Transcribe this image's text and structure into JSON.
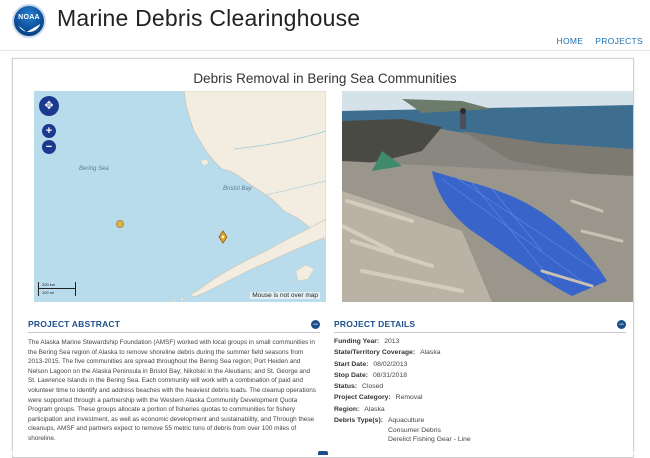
{
  "header": {
    "logo_text": "NOAA",
    "title": "Marine Debris Clearinghouse",
    "nav": [
      "HOME",
      "PROJECTS"
    ]
  },
  "page": {
    "title": "Debris Removal in Bering Sea Communities"
  },
  "map": {
    "sea_label": "Bering Sea",
    "bay_label": "Bristol Bay",
    "status": "Mouse is not over map",
    "scale_labels": [
      "200 km",
      "100 mi"
    ]
  },
  "abstract": {
    "heading": "PROJECT ABSTRACT",
    "text": "The Alaska Marine Stewardship Foundation (AMSF) worked with local groups in small communities in the Bering Sea region of Alaska to remove shoreline debris during the summer field seasons from 2013-2015. The five communities are spread throughout the Bering Sea region; Port Heiden and Nelson Lagoon on the Alaska Peninsula in Bristol Bay; Nikolski in the Aleutians; and St. George and St. Lawrence Islands in the Bering Sea. Each community will work with a combination of paid and volunteer time to identify and address beaches with the heaviest debris loads. The cleanup operations were supported through a partnership with the Western Alaska Community Development Quota Program groups. These groups allocate a portion of fisheries quotas to communities for fishery participation and investment, as well as economic development and sustainability, and Through these cleanups, AMSF and partners expect to remove 55 metric tons of debris from over 100 miles of shoreline."
  },
  "details": {
    "heading": "PROJECT DETAILS",
    "rows": [
      {
        "label": "Funding Year:",
        "value": "2013"
      },
      {
        "label": "State/Territory Coverage:",
        "value": "Alaska"
      },
      {
        "label": "Start Date:",
        "value": "08/02/2013"
      },
      {
        "label": "Stop Date:",
        "value": "08/31/2018"
      },
      {
        "label": "Status:",
        "value": "Closed"
      },
      {
        "label": "Project Category:",
        "value": "Removal"
      },
      {
        "label": "Region:",
        "value": "Alaska"
      }
    ],
    "debris_label": "Debris Type(s):",
    "debris_types": [
      "Aquaculture",
      "Consumer Debris",
      "Derelict Fishing Gear - Line"
    ]
  },
  "colors": {
    "accent": "#1c4f8a",
    "link": "#1a6fb3",
    "water": "#b9dcec",
    "land": "#f2ede0"
  }
}
